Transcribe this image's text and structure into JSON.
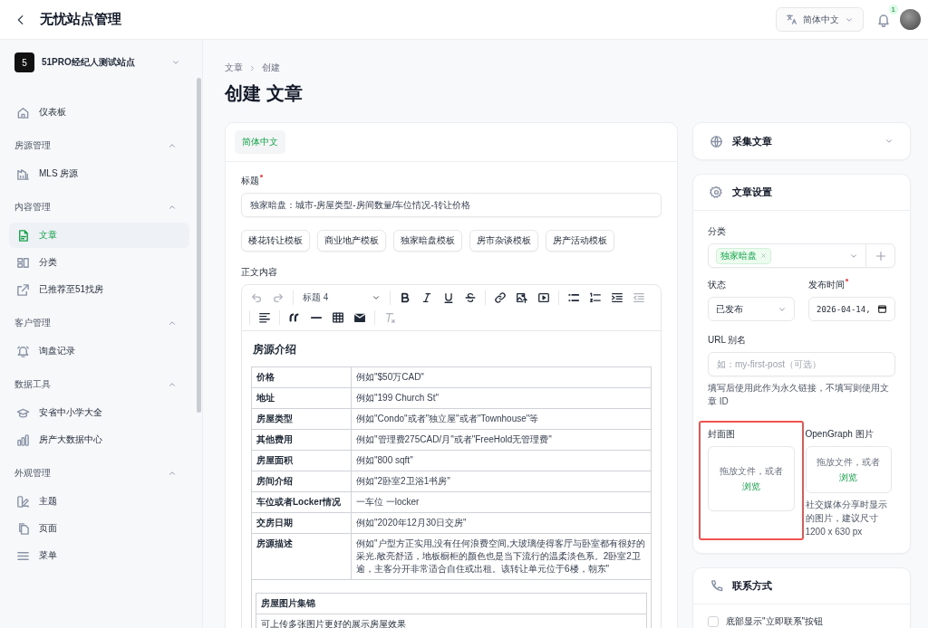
{
  "header": {
    "title": "无忧站点管理",
    "language": "简体中文",
    "notification_count": "1"
  },
  "sidebar": {
    "site": {
      "badge": "5",
      "name": "51PRO经纪人测试站点"
    },
    "sections": [
      {
        "items": [
          {
            "label": "仪表板",
            "selected": false
          }
        ]
      },
      {
        "title": "房源管理",
        "expanded": true,
        "items": [
          {
            "label": "MLS 房源",
            "selected": false
          }
        ]
      },
      {
        "title": "内容管理",
        "expanded": true,
        "items": [
          {
            "label": "文章",
            "selected": true
          },
          {
            "label": "分类",
            "selected": false
          },
          {
            "label": "已推荐至51找房",
            "selected": false
          }
        ]
      },
      {
        "title": "客户管理",
        "expanded": true,
        "items": [
          {
            "label": "询盘记录",
            "selected": false
          }
        ]
      },
      {
        "title": "数据工具",
        "expanded": true,
        "items": [
          {
            "label": "安省中小学大全",
            "selected": false
          },
          {
            "label": "房产大数据中心",
            "selected": false
          }
        ]
      },
      {
        "title": "外观管理",
        "expanded": true,
        "items": [
          {
            "label": "主题",
            "selected": false
          },
          {
            "label": "页面",
            "selected": false
          },
          {
            "label": "菜单",
            "selected": false
          }
        ]
      }
    ]
  },
  "breadcrumb": [
    "文章",
    "创建"
  ],
  "page_title": "创建 文章",
  "editor": {
    "tabs": [
      {
        "label": "简体中文",
        "selected": true
      }
    ],
    "title_field": {
      "label": "标题",
      "required": true,
      "value": "独家暗盘：城市-房屋类型-房间数量/车位情况-转让价格"
    },
    "templates": [
      "楼花转让模板",
      "商业地产模板",
      "独家暗盘模板",
      "房市杂谈模板",
      "房产活动模板"
    ],
    "body_label": "正文内容",
    "heading_select": "标题 4",
    "content": {
      "heading": "房源介绍",
      "rows": [
        {
          "label": "价格",
          "value": "例如\"$50万CAD\""
        },
        {
          "label": "地址",
          "value": "例如\"199 Church St\""
        },
        {
          "label": "房屋类型",
          "value": "例如\"Condo\"或者\"独立屋\"或者\"Townhouse\"等"
        },
        {
          "label": "其他费用",
          "value": "例如\"管理费275CAD/月\"或者\"FreeHold无管理费\""
        },
        {
          "label": "房屋面积",
          "value": "例如\"800 sqft\""
        },
        {
          "label": "房间介绍",
          "value": "例如\"2卧室2卫浴1书房\""
        },
        {
          "label": "车位或者Locker情况",
          "value": "一车位 一locker"
        },
        {
          "label": "交房日期",
          "value": "例如\"2020年12月30日交房\""
        },
        {
          "label": "房源描述",
          "value": "例如\"户型方正实用,没有任何浪费空间,大玻璃使得客厅与卧室都有很好的采光.敞亮舒适，地板橱柜的颜色也是当下流行的温柔淡色系。2卧室2卫逾，主客分开非常适合自住或出租。该转让单元位于6楼，朝东\""
        }
      ],
      "gallery": {
        "title": "房屋图片集锦",
        "text": "可上传多张图片更好的展示房屋效果"
      }
    }
  },
  "collect_card": {
    "title": "采集文章",
    "expanded": false
  },
  "settings_card": {
    "title": "文章设置",
    "category": {
      "label": "分类",
      "tags": [
        "独家暗盘"
      ]
    },
    "status": {
      "label": "状态",
      "value": "已发布"
    },
    "publish_time": {
      "label": "发布时间",
      "required": true,
      "value": "2026-04-14,"
    },
    "url_alias": {
      "label": "URL 别名",
      "placeholder": "如：my-first-post（可选）",
      "help": "填写后使用此作为永久链接，不填写则使用文章 ID"
    },
    "cover": {
      "label": "封面图",
      "drop_text": "拖放文件，或者",
      "browse": "浏览",
      "highlighted": true
    },
    "og_image": {
      "label": "OpenGraph 图片",
      "drop_text": "拖放文件，或者",
      "browse": "浏览",
      "highlighted": false,
      "help": "社交媒体分享时显示的图片，建议尺寸 1200 x 630 px"
    }
  },
  "contact_card": {
    "title": "联系方式",
    "checkbox": {
      "label": "底部显示\"立即联系\"按钮",
      "checked": false
    }
  }
}
